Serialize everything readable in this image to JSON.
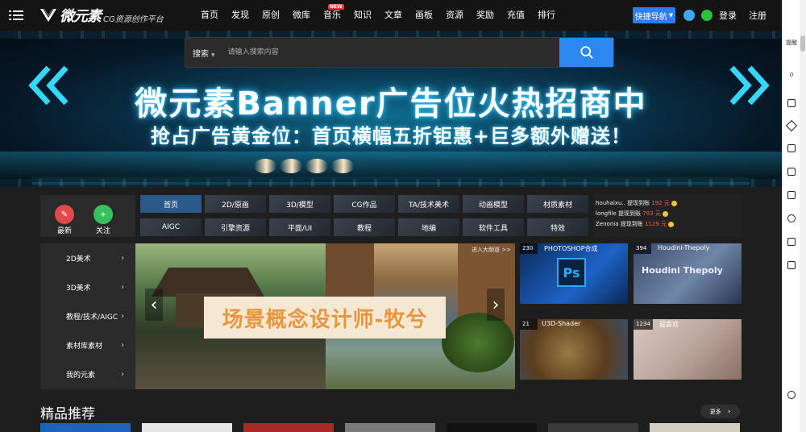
{
  "header": {
    "logo_text": "微元素",
    "logo_sub": "CG资源创作平台",
    "nav": [
      {
        "label": "首页"
      },
      {
        "label": "发现"
      },
      {
        "label": "原创"
      },
      {
        "label": "微库"
      },
      {
        "label": "音乐",
        "badge": "NEW"
      },
      {
        "label": "知识"
      },
      {
        "label": "文章"
      },
      {
        "label": "画板"
      },
      {
        "label": "资源"
      },
      {
        "label": "奖励"
      },
      {
        "label": "充值"
      },
      {
        "label": "排行"
      }
    ],
    "quick_nav": "快捷导航",
    "login": "登录",
    "register": "注册"
  },
  "search": {
    "scope": "搜索",
    "placeholder": "请输入搜索内容"
  },
  "banner": {
    "headline": "微元素Banner广告位火热招商中",
    "subline": "抢占广告黄金位：首页横幅五折钜惠+巨多额外赠送！"
  },
  "right_sidebar": {
    "tip": "提醒",
    "count": "0"
  },
  "quick_actions": [
    {
      "label": "最新",
      "icon": "tag-icon"
    },
    {
      "label": "关注",
      "icon": "user-plus-icon"
    }
  ],
  "categories": [
    "首页",
    "2D/原画",
    "3D/模型",
    "CG作品",
    "TA/技术美术",
    "动画模型",
    "材质素材",
    "AIGC",
    "引擎资源",
    "平面/UI",
    "教程",
    "地编",
    "软件工具",
    "特效"
  ],
  "ranking": [
    {
      "user": "houhaixu..",
      "action": "提现到账",
      "amount": "192 元"
    },
    {
      "user": "longfile",
      "action": "提现到账",
      "amount": "793 元"
    },
    {
      "user": "Zenonia",
      "action": "提现到账",
      "amount": "1129 元"
    }
  ],
  "submenu": [
    "2D美术",
    "3D美术",
    "教程/技术/AIGC",
    "素材库素材",
    "我的元素"
  ],
  "carousel": {
    "enter_link": "进入大频道 >>",
    "caption": "场景概念设计师-牧兮"
  },
  "thumbnails": [
    {
      "count": "230",
      "title": "PHOTOSHOP合成",
      "logo": "Ps"
    },
    {
      "count": "394",
      "title": "Houdini-Thepoly",
      "overlay": "Houdini Thepoly"
    },
    {
      "count": "21",
      "title": "U3D-Shader"
    },
    {
      "count": "1234",
      "title": "超喜欢"
    }
  ],
  "section": {
    "title": "精品推荐",
    "more": "更多"
  },
  "colors": {
    "accent": "#2d87f0",
    "background": "#1e1e1e",
    "topbar": "#141414",
    "amount": "#ff5a4a"
  }
}
